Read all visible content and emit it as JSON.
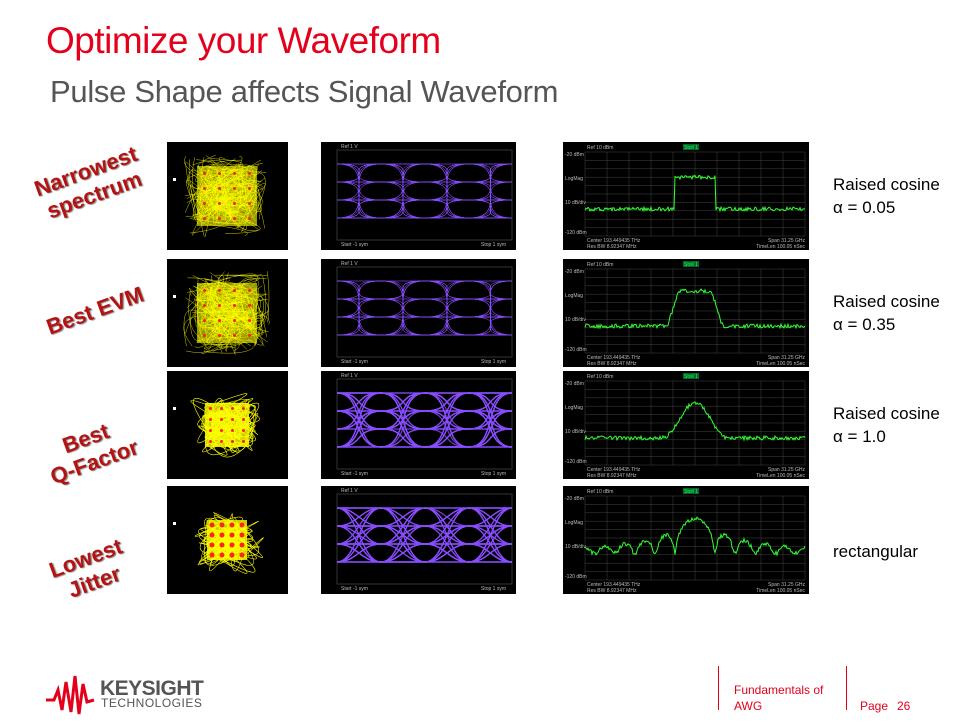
{
  "title": "Optimize your Waveform",
  "subtitle": "Pulse Shape affects Signal Waveform",
  "rows": [
    {
      "label_lines": [
        "Narrowest",
        "spectrum"
      ],
      "desc_line1": "Raised cosine",
      "desc_line2": "α = 0.05",
      "alpha": 0.05
    },
    {
      "label_lines": [
        "Best EVM"
      ],
      "desc_line1": "Raised cosine",
      "desc_line2": "α = 0.35",
      "alpha": 0.35
    },
    {
      "label_lines": [
        "Best",
        "Q-Factor"
      ],
      "desc_line1": "Raised cosine",
      "desc_line2": "α = 1.0",
      "alpha": 1.0
    },
    {
      "label_lines": [
        "Lowest",
        "Jitter"
      ],
      "desc_line1": "rectangular",
      "desc_line2": "",
      "alpha": null
    }
  ],
  "spectrum": {
    "ref": "Ref 10 dBm",
    "marker": "Stoll 1",
    "top": "-20 dBm",
    "scale": "LogMag",
    "mid": "10 dB/div",
    "bottom": "-120 dBm",
    "center": "Center 193.449435 THz",
    "rbw": "Res BW 8.92347 MHz",
    "span": "Span 31.25 GHz",
    "timelen": "TimeLen 100.05 nSec"
  },
  "eye": {
    "ref": "Ref 1 V",
    "start": "Start -1 sym",
    "stop": "Stop 1 sym"
  },
  "colors": {
    "constellation": "#ffff00",
    "points": "#ff2020",
    "eye": "#8a4dff",
    "spectrum": "#33ff33",
    "accent": "#e4001b"
  },
  "footer": {
    "logo_main": "KEYSIGHT",
    "logo_sub": "TECHNOLOGIES",
    "doc_line1": "Fundamentals of",
    "doc_line2": "AWG",
    "page_label": "Page",
    "page_number": "26"
  }
}
